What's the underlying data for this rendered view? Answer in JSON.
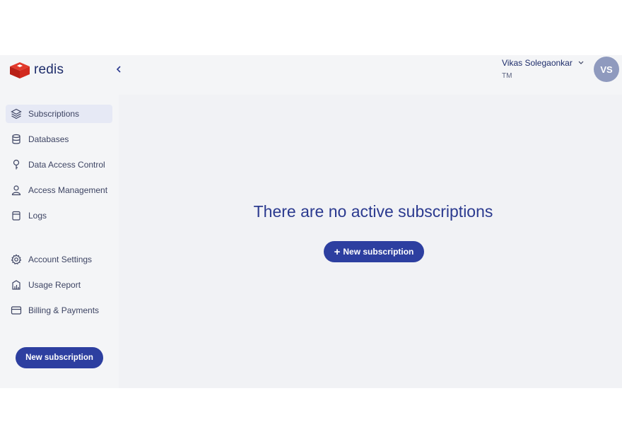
{
  "brand": {
    "name": "redis",
    "accent": "#2d3fa0",
    "logo_color": "#d82c20"
  },
  "user": {
    "name": "Vikas Solegaonkar",
    "org": "TM",
    "initials": "VS"
  },
  "sidebar": {
    "items": [
      {
        "label": "Subscriptions",
        "icon": "layers-icon",
        "active": true
      },
      {
        "label": "Databases",
        "icon": "database-icon"
      },
      {
        "label": "Data Access Control",
        "icon": "pin-icon"
      },
      {
        "label": "Access Management",
        "icon": "user-icon"
      },
      {
        "label": "Logs",
        "icon": "log-icon"
      },
      {
        "label": "Account Settings",
        "icon": "gear-icon"
      },
      {
        "label": "Usage Report",
        "icon": "report-icon"
      },
      {
        "label": "Billing & Payments",
        "icon": "card-icon"
      }
    ],
    "button_label": "New subscription"
  },
  "main": {
    "empty_title": "There are no active subscriptions",
    "button_label": "New subscription"
  }
}
